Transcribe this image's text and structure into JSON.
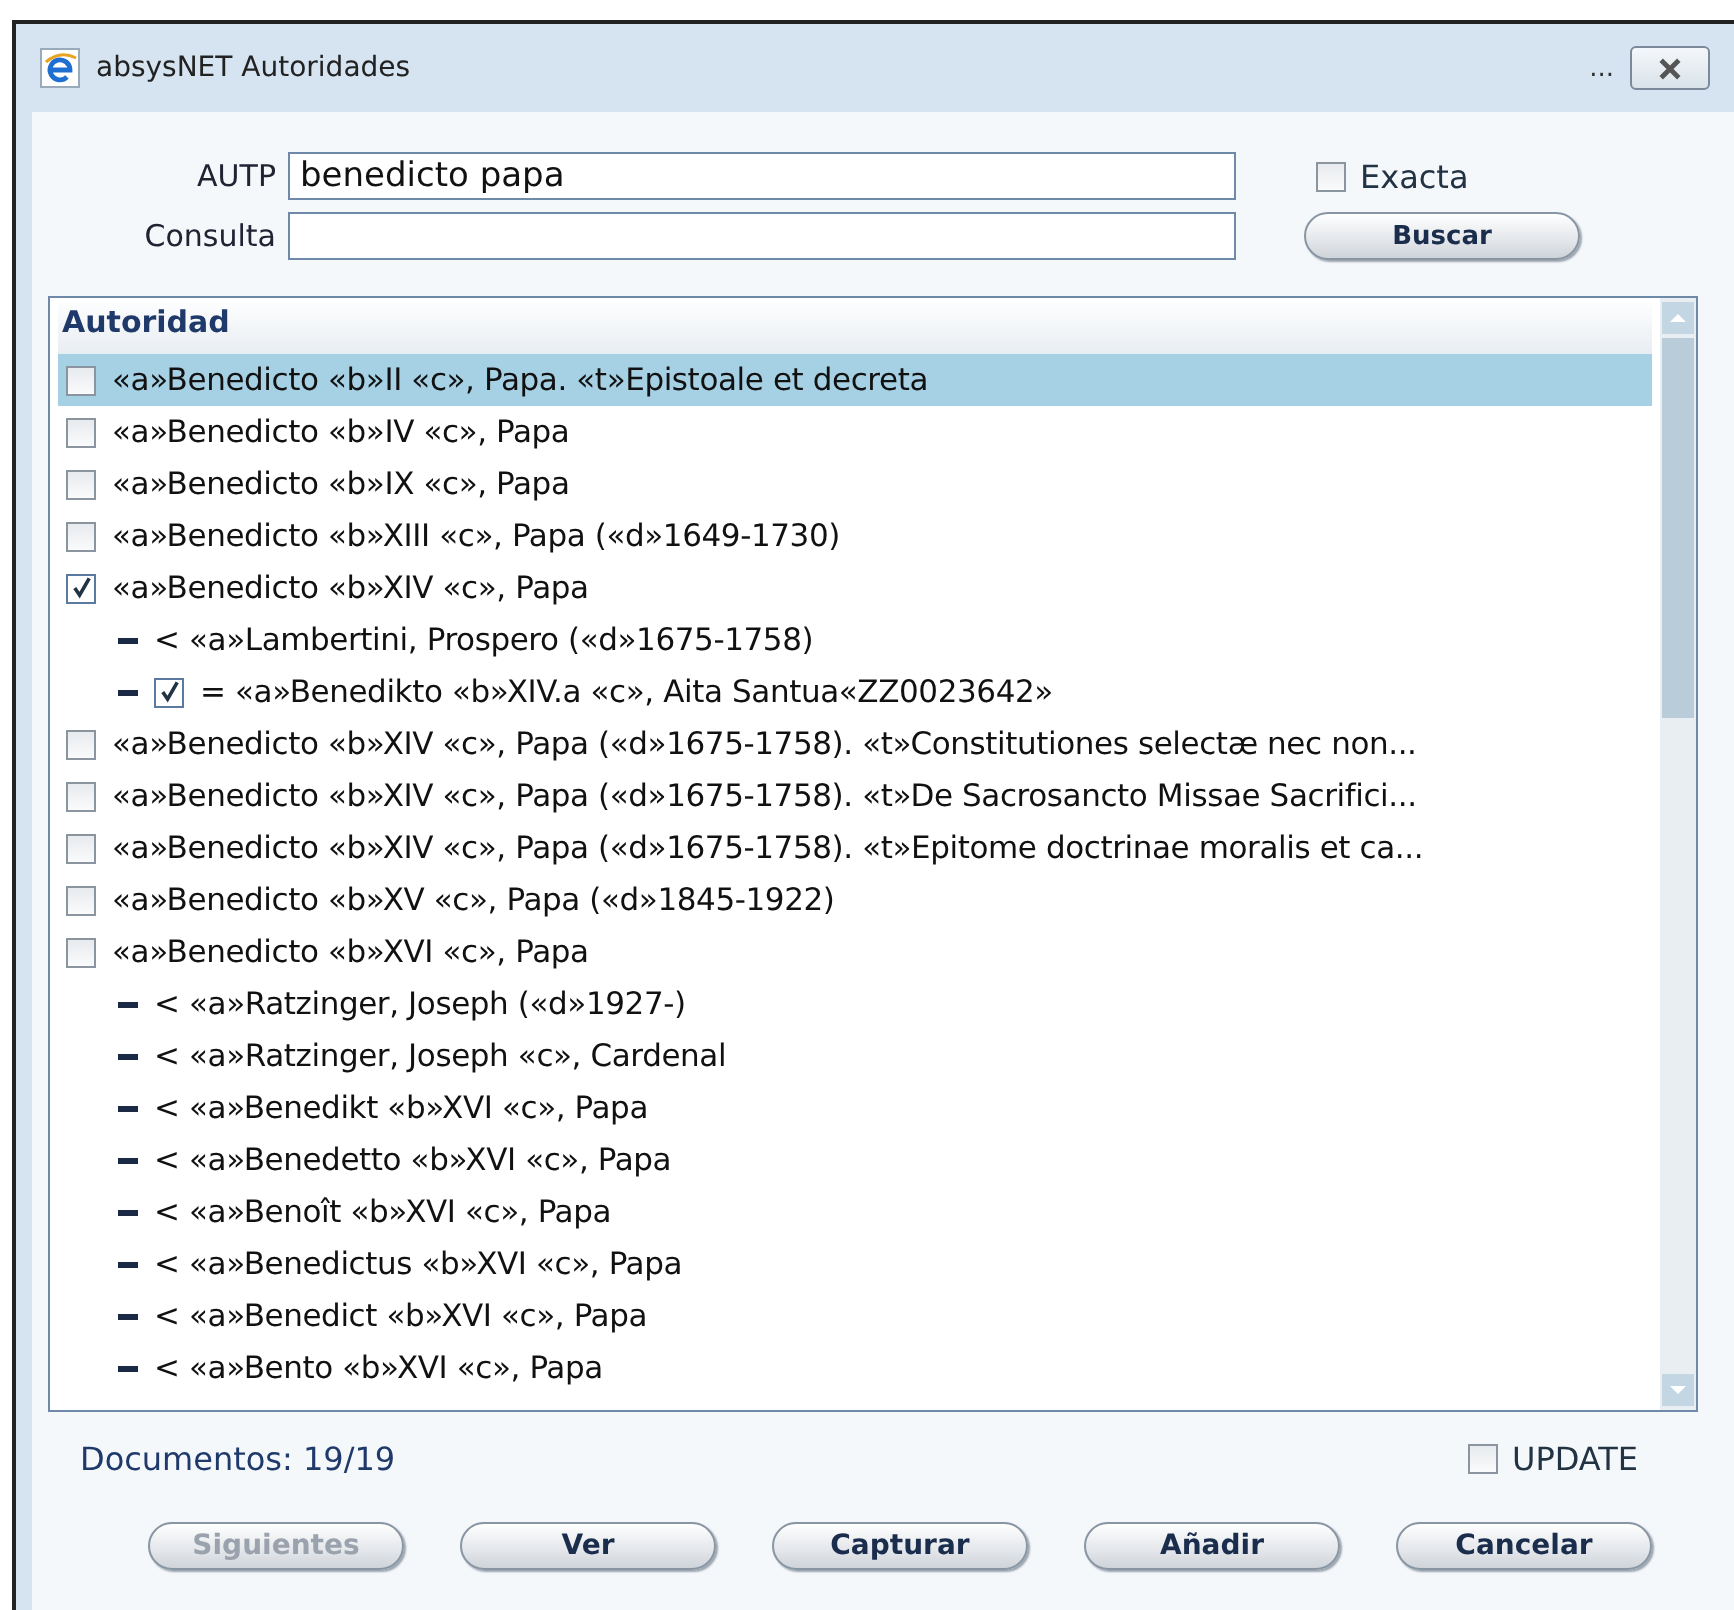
{
  "window": {
    "title": "absysNET Autoridades",
    "more": "..."
  },
  "search": {
    "autp_label": "AUTP",
    "autp_value": "benedicto papa",
    "consulta_label": "Consulta",
    "exacta": {
      "label": "Exacta",
      "checked": false
    },
    "search_button": "Buscar"
  },
  "list": {
    "header": "Autoridad",
    "items": [
      {
        "text": "«a»Benedicto «b»II «c», Papa. «t»Epistoale et decreta",
        "checked": false,
        "selected": true
      },
      {
        "text": "«a»Benedicto «b»IV «c», Papa",
        "checked": false,
        "selected": false
      },
      {
        "text": "«a»Benedicto «b»IX «c», Papa",
        "checked": false,
        "selected": false
      },
      {
        "text": "«a»Benedicto «b»XIII «c», Papa («d»1649-1730)",
        "checked": false,
        "selected": false
      },
      {
        "text": "«a»Benedicto «b»XIV «c», Papa",
        "checked": true,
        "selected": false,
        "children": [
          {
            "kind": "plain",
            "text": "< «a»Lambertini, Prospero («d»1675-1758)"
          },
          {
            "kind": "checkbox",
            "checked": true,
            "text": "= «a»Benedikto «b»XIV.a «c», Aita Santua«ZZ0023642»"
          }
        ]
      },
      {
        "text": "«a»Benedicto «b»XIV «c», Papa («d»1675-1758). «t»Constitutiones selectæ nec non...",
        "checked": false,
        "selected": false
      },
      {
        "text": "«a»Benedicto «b»XIV «c», Papa («d»1675-1758). «t»De Sacrosancto Missae Sacrifici...",
        "checked": false,
        "selected": false
      },
      {
        "text": "«a»Benedicto «b»XIV «c», Papa («d»1675-1758). «t»Epitome doctrinae moralis et ca...",
        "checked": false,
        "selected": false
      },
      {
        "text": "«a»Benedicto «b»XV «c», Papa («d»1845-1922)",
        "checked": false,
        "selected": false
      },
      {
        "text": "«a»Benedicto «b»XVI «c», Papa",
        "checked": false,
        "selected": false,
        "children": [
          {
            "kind": "plain",
            "text": "< «a»Ratzinger, Joseph («d»1927-)"
          },
          {
            "kind": "plain",
            "text": "< «a»Ratzinger, Joseph «c», Cardenal"
          },
          {
            "kind": "plain",
            "text": "< «a»Benedikt «b»XVI «c», Papa"
          },
          {
            "kind": "plain",
            "text": "< «a»Benedetto «b»XVI «c», Papa"
          },
          {
            "kind": "plain",
            "text": "< «a»Benoît «b»XVI «c», Papa"
          },
          {
            "kind": "plain",
            "text": "< «a»Benedictus «b»XVI «c», Papa"
          },
          {
            "kind": "plain",
            "text": "< «a»Benedict «b»XVI «c», Papa"
          },
          {
            "kind": "plain",
            "text": "< «a»Bento «b»XVI «c», Papa"
          }
        ]
      }
    ]
  },
  "documents": "Documentos: 19/19",
  "update": {
    "label": "UPDATE",
    "checked": false
  },
  "buttons": [
    {
      "label": "Siguientes",
      "disabled": true
    },
    {
      "label": "Ver",
      "disabled": false
    },
    {
      "label": "Capturar",
      "disabled": false
    },
    {
      "label": "Añadir",
      "disabled": false
    },
    {
      "label": "Cancelar",
      "disabled": false
    }
  ]
}
